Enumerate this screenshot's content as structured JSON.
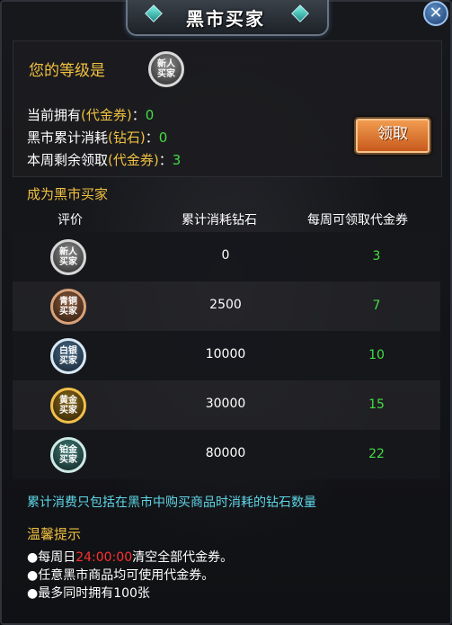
{
  "title": "黑市买家",
  "close_icon": "✕",
  "level": {
    "label": "您的等级是",
    "badge": [
      "新人",
      "买家"
    ]
  },
  "stats": [
    {
      "prefix": "当前拥有",
      "highlight": "(代金券)",
      "sep": "：",
      "value": "0"
    },
    {
      "prefix": "黑市累计消耗",
      "highlight": "(钻石)",
      "sep": "：",
      "value": "0"
    },
    {
      "prefix": "本周剩余领取",
      "highlight": "(代金券)",
      "sep": "：",
      "value": "3"
    }
  ],
  "claim_button": "领取",
  "section_title": "成为黑市买家",
  "table": {
    "headers": [
      "评价",
      "累计消耗钻石",
      "每周可领取代金券"
    ],
    "rows": [
      {
        "badge": [
          "新人",
          "买家"
        ],
        "tier": "newbie",
        "cost": "0",
        "reward": "3"
      },
      {
        "badge": [
          "青铜",
          "买家"
        ],
        "tier": "bronze",
        "cost": "2500",
        "reward": "7"
      },
      {
        "badge": [
          "白银",
          "买家"
        ],
        "tier": "silver",
        "cost": "10000",
        "reward": "10"
      },
      {
        "badge": [
          "黄金",
          "买家"
        ],
        "tier": "gold",
        "cost": "30000",
        "reward": "15"
      },
      {
        "badge": [
          "铂金",
          "买家"
        ],
        "tier": "platinum",
        "cost": "80000",
        "reward": "22"
      }
    ]
  },
  "note": "累计消费只包括在黑市中购买商品时消耗的钻石数量",
  "tips": {
    "title": "温馨提示",
    "line1_prefix": "●每周日",
    "line1_time": "24:00:00",
    "line1_suffix": "清空全部代金券。",
    "line2": "●任意黑市商品均可使用代金券。",
    "line3": "●最多同时拥有100张"
  },
  "colors": {
    "gold_text": "#f0c040",
    "value_green": "#44dd44",
    "note_cyan": "#5fd6e8",
    "warning_red": "#ff3030"
  }
}
